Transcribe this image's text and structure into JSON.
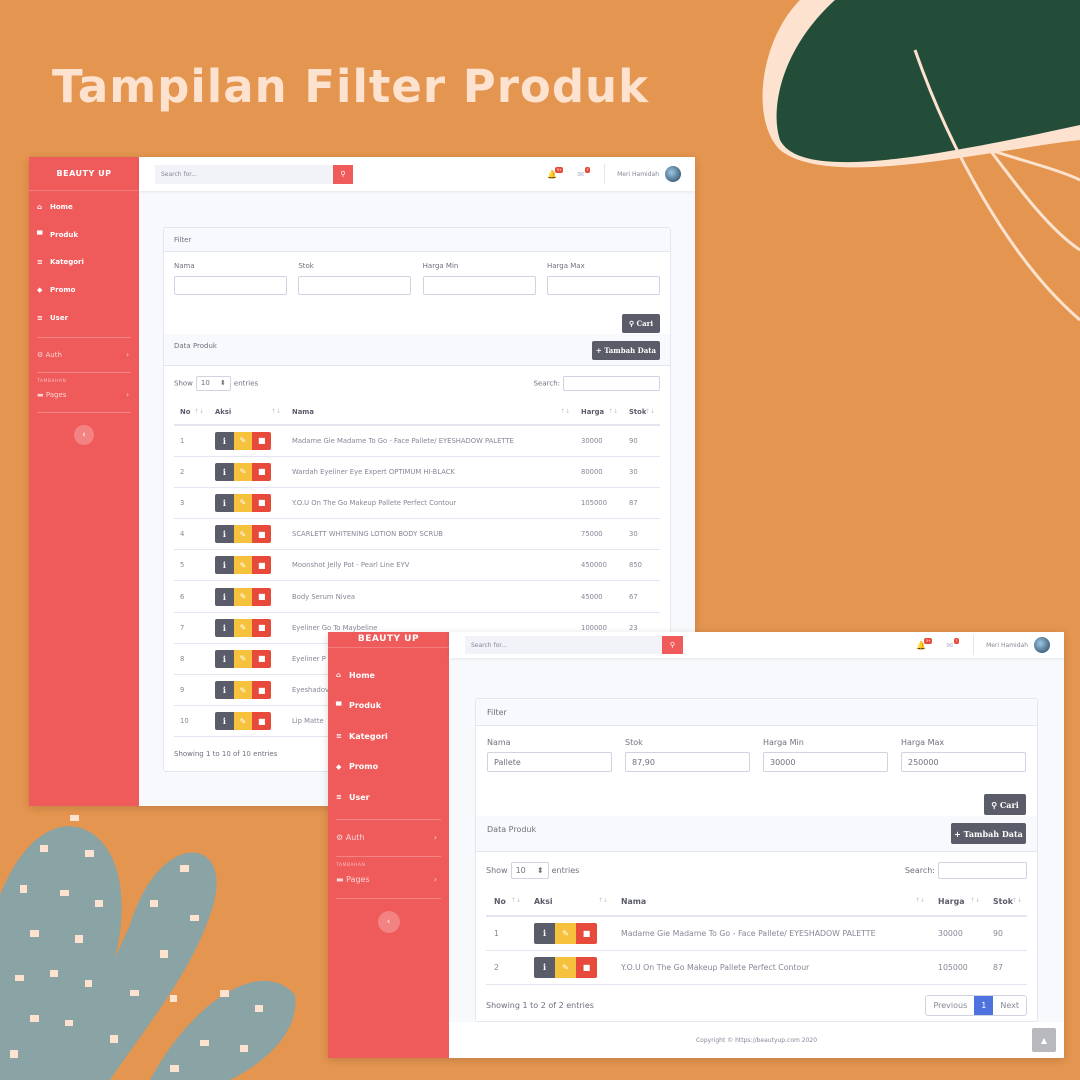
{
  "page_title": "Tampilan Filter Produk",
  "colors": {
    "background": "#e4954f",
    "sidebar": "#ef5a5a",
    "accent_dark": "#5a5c69",
    "edit": "#f6c23e",
    "delete": "#e74a3b",
    "deco_green": "#234d39",
    "deco_cream": "#fde3cf",
    "deco_teal": "#8aa3a4"
  },
  "sidebar": {
    "brand": "BEAUTY UP",
    "items": [
      {
        "label": "Home",
        "icon": "home-icon"
      },
      {
        "label": "Produk",
        "icon": "cart-icon"
      },
      {
        "label": "Kategori",
        "icon": "list-icon"
      },
      {
        "label": "Promo",
        "icon": "tags-icon"
      },
      {
        "label": "User",
        "icon": "list-icon"
      }
    ],
    "auth": "Auth",
    "heading": "TAMBAHAN",
    "pages": "Pages",
    "toggle": "‹"
  },
  "topbar": {
    "search_placeholder": "Search for...",
    "alerts_badge": "3+",
    "messages_badge": "7",
    "user_name": "Meri Hamidah"
  },
  "filter": {
    "header": "Filter",
    "labels": {
      "nama": "Nama",
      "stok": "Stok",
      "harga_min": "Harga Min",
      "harga_max": "Harga Max"
    },
    "values2": {
      "nama": "Pallete",
      "stok": "87,90",
      "harga_min": "30000",
      "harga_max": "250000"
    },
    "button": "Cari"
  },
  "data": {
    "header": "Data Produk",
    "add_button": "Tambah Data",
    "show": "Show",
    "entries_value": "10",
    "entries": "entries",
    "search": "Search:",
    "columns": [
      "No",
      "Aksi",
      "Nama",
      "Harga",
      "Stok"
    ]
  },
  "table1": [
    {
      "no": "1",
      "nama": "Madame Gie Madame To Go - Face Pallete/ EYESHADOW PALETTE",
      "harga": "30000",
      "stok": "90"
    },
    {
      "no": "2",
      "nama": "Wardah Eyeliner Eye Expert OPTIMUM HI-BLACK",
      "harga": "80000",
      "stok": "30"
    },
    {
      "no": "3",
      "nama": "Y.O.U On The Go Makeup Pallete Perfect Contour",
      "harga": "105000",
      "stok": "87"
    },
    {
      "no": "4",
      "nama": "SCARLETT WHITENING LOTION BODY SCRUB",
      "harga": "75000",
      "stok": "30"
    },
    {
      "no": "5",
      "nama": "Moonshot Jelly Pot - Pearl Line EYV",
      "harga": "450000",
      "stok": "850"
    },
    {
      "no": "6",
      "nama": "Body Serum Nivea",
      "harga": "45000",
      "stok": "67"
    },
    {
      "no": "7",
      "nama": "Eyeliner Go To Maybeline",
      "harga": "100000",
      "stok": "23"
    },
    {
      "no": "8",
      "nama": "Eyeliner P",
      "harga": "",
      "stok": ""
    },
    {
      "no": "9",
      "nama": "Eyeshadov",
      "harga": "",
      "stok": ""
    },
    {
      "no": "10",
      "nama": "Lip Matte",
      "harga": "",
      "stok": ""
    }
  ],
  "footer1": "Showing 1 to 10 of 10 entries",
  "table2": [
    {
      "no": "1",
      "nama": "Madame Gie Madame To Go - Face Pallete/ EYESHADOW PALETTE",
      "harga": "30000",
      "stok": "90"
    },
    {
      "no": "2",
      "nama": "Y.O.U On The Go Makeup Pallete Perfect Contour",
      "harga": "105000",
      "stok": "87"
    }
  ],
  "footer2": "Showing 1 to 2 of 2 entries",
  "pager": {
    "previous": "Previous",
    "page": "1",
    "next": "Next"
  },
  "copyright": "Copyright © https://beautyup.com 2020"
}
